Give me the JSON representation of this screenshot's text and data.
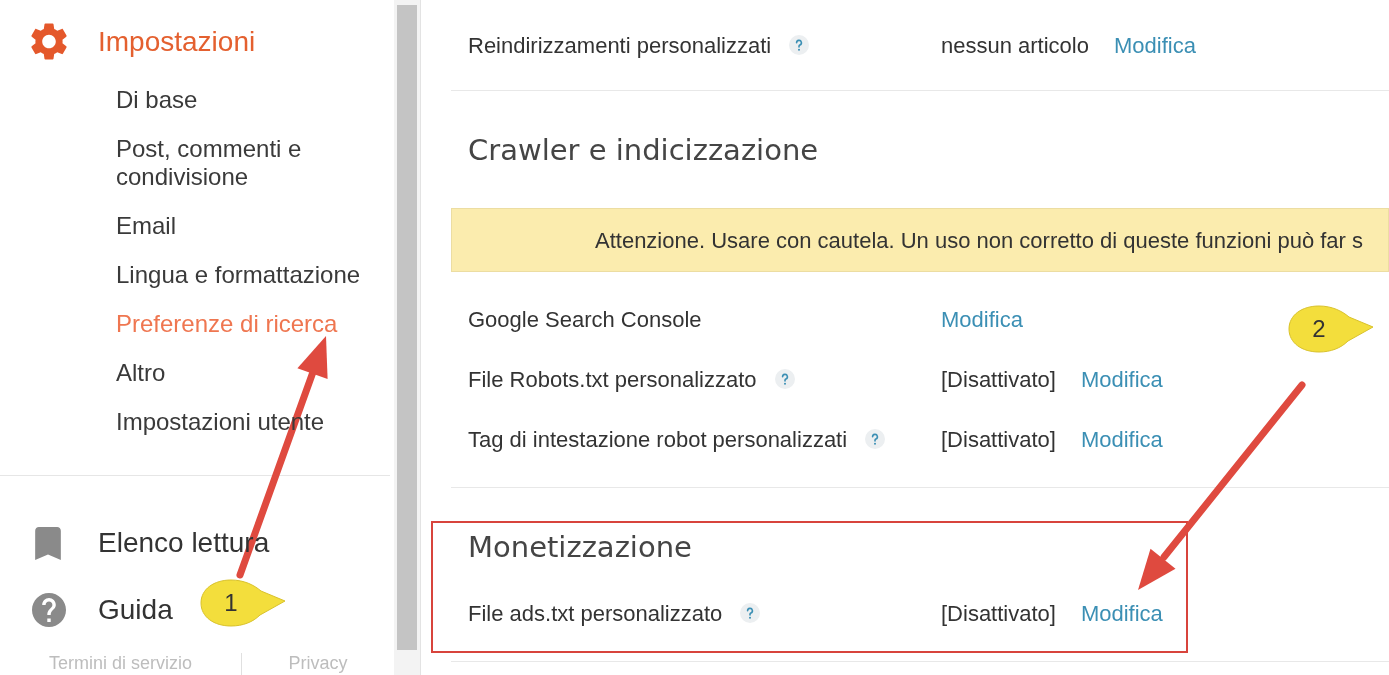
{
  "sidebar": {
    "header": {
      "label": "Impostazioni",
      "selected": true
    },
    "items": [
      {
        "label": "Di base",
        "selected": false
      },
      {
        "label": "Post, commenti e condivisione",
        "selected": false
      },
      {
        "label": "Email",
        "selected": false
      },
      {
        "label": "Lingua e formattazione",
        "selected": false
      },
      {
        "label": "Preferenze di ricerca",
        "selected": true
      },
      {
        "label": "Altro",
        "selected": false
      },
      {
        "label": "Impostazioni utente",
        "selected": false
      }
    ],
    "links": [
      {
        "kind": "bookmark",
        "label": "Elenco lettura"
      },
      {
        "kind": "help",
        "label": "Guida"
      }
    ],
    "footer_links": [
      "Termini di servizio",
      "Privacy"
    ]
  },
  "main": {
    "rows": [
      {
        "label": "Reindirizzamenti personalizzati",
        "help": true,
        "value": "nessun articolo",
        "action": "Modifica"
      }
    ],
    "sections": [
      {
        "title": "Crawler e indicizzazione",
        "highlighted": false,
        "warning": "Attenzione. Usare con cautela. Un uso non corretto di queste funzioni può far s",
        "rows": [
          {
            "label": "Google Search Console",
            "help": false,
            "action": "Modifica"
          },
          {
            "label": "File Robots.txt personalizzato",
            "help": true,
            "value": "[Disattivato]",
            "action": "Modifica"
          },
          {
            "label": "Tag di intestazione robot personalizzati",
            "help": true,
            "value": "[Disattivato]",
            "action": "Modifica"
          }
        ]
      },
      {
        "title": "Monetizzazione",
        "highlighted": true,
        "rows": [
          {
            "label": "File ads.txt personalizzato",
            "help": true,
            "value": "[Disattivato]",
            "action": "Modifica"
          }
        ]
      }
    ]
  },
  "annotations": {
    "callouts": [
      {
        "label": "1"
      },
      {
        "label": "2"
      }
    ]
  }
}
